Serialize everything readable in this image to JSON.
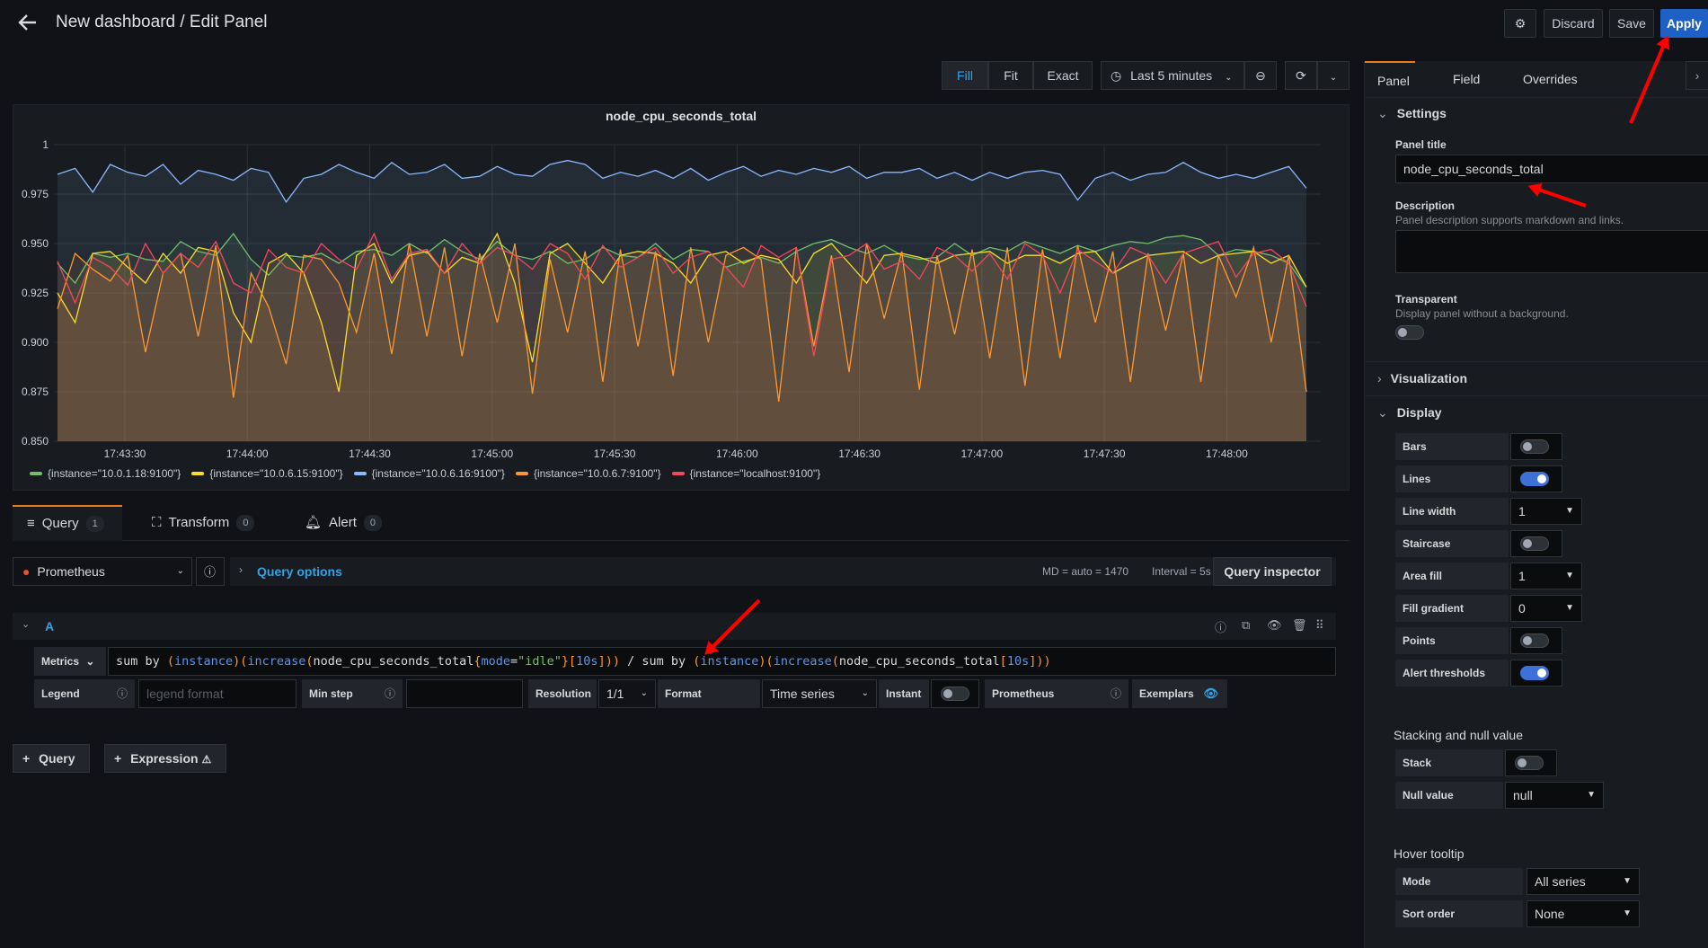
{
  "header": {
    "title": "New dashboard / Edit Panel",
    "discard_label": "Discard",
    "save_label": "Save",
    "apply_label": "Apply"
  },
  "toolbar": {
    "fill_label": "Fill",
    "fit_label": "Fit",
    "exact_label": "Exact",
    "time_range": "Last 5 minutes"
  },
  "panel": {
    "title": "node_cpu_seconds_total"
  },
  "chart_data": {
    "type": "area",
    "title": "node_cpu_seconds_total",
    "ylim": [
      0.85,
      1.0
    ],
    "yticks": [
      "1",
      "0.975",
      "0.950",
      "0.925",
      "0.900",
      "0.875",
      "0.850"
    ],
    "xticks": [
      "17:43:30",
      "17:44:00",
      "17:44:30",
      "17:45:00",
      "17:45:30",
      "17:46:00",
      "17:46:30",
      "17:47:00",
      "17:47:30",
      "17:48:00"
    ],
    "grid": true,
    "legend_position": "bottom-left",
    "series": [
      {
        "name": "{instance=\"10.0.1.18:9100\"}",
        "color": "#73bf69",
        "values": [
          0.94,
          0.93,
          0.945,
          0.943,
          0.945,
          0.942,
          0.941,
          0.951,
          0.946,
          0.944,
          0.955,
          0.942,
          0.934,
          0.944,
          0.943,
          0.945,
          0.94,
          0.946,
          0.947,
          0.944,
          0.95,
          0.945,
          0.952,
          0.946,
          0.942,
          0.951,
          0.944,
          0.942,
          0.946,
          0.94,
          0.942,
          0.948,
          0.944,
          0.943,
          0.95,
          0.942,
          0.947,
          0.946,
          0.938,
          0.941,
          0.943,
          0.94,
          0.946,
          0.95,
          0.952,
          0.948,
          0.945,
          0.949,
          0.944,
          0.942,
          0.943,
          0.95,
          0.944,
          0.948,
          0.946,
          0.951,
          0.948,
          0.945,
          0.949,
          0.946,
          0.949,
          0.951,
          0.95,
          0.953,
          0.954,
          0.952,
          0.944,
          0.947,
          0.946,
          0.944,
          0.94,
          0.928
        ]
      },
      {
        "name": "{instance=\"10.0.6.15:9100\"}",
        "color": "#fade2a",
        "values": [
          0.925,
          0.91,
          0.945,
          0.946,
          0.938,
          0.93,
          0.945,
          0.935,
          0.948,
          0.946,
          0.915,
          0.9,
          0.94,
          0.945,
          0.935,
          0.91,
          0.875,
          0.944,
          0.95,
          0.93,
          0.944,
          0.946,
          0.935,
          0.943,
          0.94,
          0.955,
          0.93,
          0.89,
          0.945,
          0.95,
          0.94,
          0.93,
          0.944,
          0.946,
          0.945,
          0.94,
          0.93,
          0.944,
          0.946,
          0.94,
          0.944,
          0.942,
          0.93,
          0.945,
          0.95,
          0.94,
          0.93,
          0.944,
          0.945,
          0.943,
          0.94,
          0.944,
          0.945,
          0.946,
          0.94,
          0.944,
          0.944,
          0.94,
          0.945,
          0.946,
          0.935,
          0.94,
          0.944,
          0.945,
          0.946,
          0.94,
          0.944,
          0.945,
          0.946,
          0.94,
          0.944,
          0.928
        ]
      },
      {
        "name": "{instance=\"10.0.6.16:9100\"}",
        "color": "#8ab8ff",
        "values": [
          0.985,
          0.988,
          0.976,
          0.99,
          0.986,
          0.984,
          0.99,
          0.98,
          0.987,
          0.985,
          0.982,
          0.988,
          0.986,
          0.971,
          0.983,
          0.985,
          0.99,
          0.986,
          0.983,
          0.991,
          0.985,
          0.986,
          0.99,
          0.983,
          0.984,
          0.989,
          0.985,
          0.984,
          0.99,
          0.992,
          0.99,
          0.983,
          0.986,
          0.984,
          0.987,
          0.983,
          0.988,
          0.982,
          0.986,
          0.989,
          0.984,
          0.987,
          0.985,
          0.988,
          0.986,
          0.989,
          0.983,
          0.986,
          0.986,
          0.988,
          0.983,
          0.986,
          0.982,
          0.986,
          0.983,
          0.986,
          0.987,
          0.985,
          0.972,
          0.983,
          0.986,
          0.982,
          0.985,
          0.986,
          0.991,
          0.986,
          0.983,
          0.985,
          0.983,
          0.986,
          0.989,
          0.978
        ]
      },
      {
        "name": "{instance=\"10.0.6.7:9100\"}",
        "color": "#ff9830",
        "values": [
          0.917,
          0.945,
          0.937,
          0.931,
          0.944,
          0.895,
          0.935,
          0.945,
          0.903,
          0.949,
          0.872,
          0.935,
          0.918,
          0.889,
          0.944,
          0.942,
          0.93,
          0.905,
          0.945,
          0.894,
          0.95,
          0.903,
          0.948,
          0.893,
          0.945,
          0.91,
          0.95,
          0.874,
          0.942,
          0.905,
          0.946,
          0.88,
          0.947,
          0.898,
          0.946,
          0.883,
          0.948,
          0.9,
          0.944,
          0.948,
          0.942,
          0.87,
          0.948,
          0.898,
          0.944,
          0.885,
          0.95,
          0.912,
          0.946,
          0.876,
          0.944,
          0.904,
          0.947,
          0.892,
          0.948,
          0.878,
          0.947,
          0.892,
          0.949,
          0.91,
          0.946,
          0.88,
          0.945,
          0.906,
          0.945,
          0.88,
          0.944,
          0.923,
          0.948,
          0.9,
          0.944,
          0.875
        ]
      },
      {
        "name": "{instance=\"localhost:9100\"}",
        "color": "#f2495c",
        "values": [
          0.941,
          0.92,
          0.943,
          0.938,
          0.929,
          0.95,
          0.935,
          0.945,
          0.938,
          0.951,
          0.93,
          0.925,
          0.947,
          0.938,
          0.935,
          0.95,
          0.942,
          0.937,
          0.955,
          0.932,
          0.945,
          0.947,
          0.935,
          0.95,
          0.94,
          0.948,
          0.944,
          0.937,
          0.95,
          0.945,
          0.932,
          0.949,
          0.938,
          0.943,
          0.948,
          0.935,
          0.943,
          0.946,
          0.938,
          0.928,
          0.949,
          0.943,
          0.948,
          0.893,
          0.942,
          0.944,
          0.95,
          0.937,
          0.941,
          0.932,
          0.948,
          0.944,
          0.936,
          0.945,
          0.932,
          0.95,
          0.944,
          0.925,
          0.947,
          0.941,
          0.935,
          0.948,
          0.944,
          0.93,
          0.945,
          0.948,
          0.951,
          0.933,
          0.945,
          0.947,
          0.94,
          0.918
        ]
      }
    ]
  },
  "legend": [
    {
      "label": "{instance=\"10.0.1.18:9100\"}",
      "color": "#73bf69"
    },
    {
      "label": "{instance=\"10.0.6.15:9100\"}",
      "color": "#fade2a"
    },
    {
      "label": "{instance=\"10.0.6.16:9100\"}",
      "color": "#8ab8ff"
    },
    {
      "label": "{instance=\"10.0.6.7:9100\"}",
      "color": "#ff9830"
    },
    {
      "label": "{instance=\"localhost:9100\"}",
      "color": "#f2495c"
    }
  ],
  "query_tabs": {
    "query_label": "Query",
    "query_count": "1",
    "transform_label": "Transform",
    "transform_count": "0",
    "alert_label": "Alert",
    "alert_count": "0"
  },
  "query": {
    "datasource": "Prometheus",
    "options_label": "Query options",
    "md_info": "MD = auto = 1470",
    "interval_info": "Interval = 5s",
    "inspector_label": "Query inspector",
    "ref_id": "A",
    "metrics_label": "Metrics",
    "expr_parts": [
      {
        "t": "sum ",
        "c": "#d8d9da"
      },
      {
        "t": "by ",
        "c": "#d8d9da"
      },
      {
        "t": "(",
        "c": "#ff9830"
      },
      {
        "t": "instance",
        "c": "#5794f2"
      },
      {
        "t": ")(",
        "c": "#ff9830"
      },
      {
        "t": "increase",
        "c": "#5794f2"
      },
      {
        "t": "(",
        "c": "#ff9830"
      },
      {
        "t": "node_cpu_seconds_total",
        "c": "#d8d9da"
      },
      {
        "t": "{",
        "c": "#ff9830"
      },
      {
        "t": "mode",
        "c": "#5794f2"
      },
      {
        "t": "=",
        "c": "#d8d9da"
      },
      {
        "t": "\"idle\"",
        "c": "#73bf69"
      },
      {
        "t": "}[",
        "c": "#ff9830"
      },
      {
        "t": "10s",
        "c": "#5794f2"
      },
      {
        "t": "])) ",
        "c": "#ff9830"
      },
      {
        "t": "/ sum ",
        "c": "#d8d9da"
      },
      {
        "t": "by ",
        "c": "#d8d9da"
      },
      {
        "t": "(",
        "c": "#ff9830"
      },
      {
        "t": "instance",
        "c": "#5794f2"
      },
      {
        "t": ")(",
        "c": "#ff9830"
      },
      {
        "t": "increase",
        "c": "#5794f2"
      },
      {
        "t": "(",
        "c": "#ff9830"
      },
      {
        "t": "node_cpu_seconds_total",
        "c": "#d8d9da"
      },
      {
        "t": "[",
        "c": "#ff9830"
      },
      {
        "t": "10s",
        "c": "#5794f2"
      },
      {
        "t": "]))",
        "c": "#ff9830"
      }
    ],
    "legend_label": "Legend",
    "legend_placeholder": "legend format",
    "minstep_label": "Min step",
    "resolution_label": "Resolution",
    "resolution_value": "1/1",
    "format_label": "Format",
    "format_value": "Time series",
    "instant_label": "Instant",
    "prometheus_label": "Prometheus",
    "exemplars_label": "Exemplars",
    "add_query_label": "Query",
    "add_expression_label": "Expression"
  },
  "options_pane": {
    "tabs": [
      "Panel",
      "Field",
      "Overrides"
    ],
    "settings_label": "Settings",
    "panel_title_label": "Panel title",
    "panel_title_value": "node_cpu_seconds_total",
    "description_label": "Description",
    "description_hint": "Panel description supports markdown and links.",
    "transparent_label": "Transparent",
    "transparent_hint": "Display panel without a background.",
    "visualization_label": "Visualization",
    "display_label": "Display",
    "display_options": [
      {
        "label": "Bars",
        "type": "toggle",
        "on": false
      },
      {
        "label": "Lines",
        "type": "toggle",
        "on": true
      },
      {
        "label": "Line width",
        "type": "select",
        "value": "1"
      },
      {
        "label": "Staircase",
        "type": "toggle",
        "on": false
      },
      {
        "label": "Area fill",
        "type": "select",
        "value": "1"
      },
      {
        "label": "Fill gradient",
        "type": "select",
        "value": "0"
      },
      {
        "label": "Points",
        "type": "toggle",
        "on": false
      },
      {
        "label": "Alert thresholds",
        "type": "toggle",
        "on": true
      }
    ],
    "stacking_label": "Stacking and null value",
    "stack_label": "Stack",
    "null_value_label": "Null value",
    "null_value": "null",
    "hover_tooltip_label": "Hover tooltip",
    "mode_label": "Mode",
    "mode_value": "All series",
    "sort_order_label": "Sort order",
    "sort_order_value": "None"
  }
}
